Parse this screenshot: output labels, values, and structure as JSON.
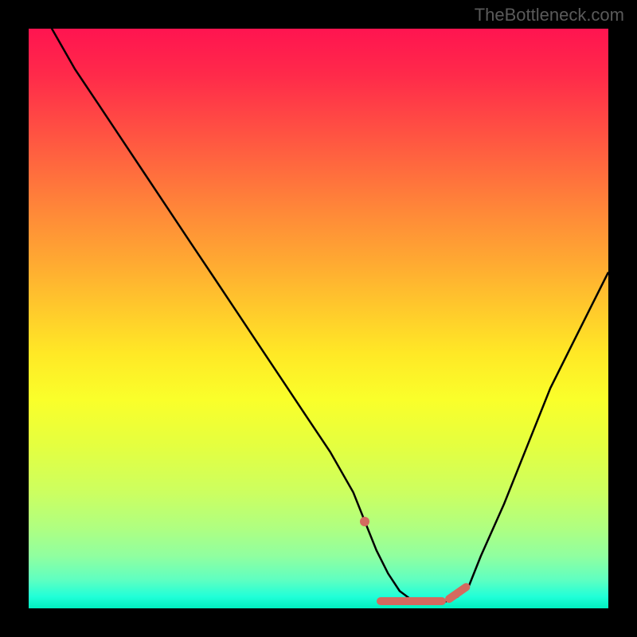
{
  "watermark": "TheBottleneck.com",
  "colors": {
    "background": "#000000",
    "curve": "#000000",
    "marker": "#d46a5f",
    "gradient_top": "#ff1450",
    "gradient_mid": "#ffe826",
    "gradient_bottom": "#00f0c0"
  },
  "chart_data": {
    "type": "line",
    "title": "",
    "xlabel": "",
    "ylabel": "",
    "xlim": [
      0,
      100
    ],
    "ylim": [
      0,
      100
    ],
    "x": [
      0,
      4,
      8,
      12,
      16,
      20,
      24,
      28,
      32,
      36,
      40,
      44,
      48,
      52,
      56,
      58,
      60,
      62,
      64,
      66,
      68,
      70,
      72,
      74,
      76,
      78,
      82,
      86,
      90,
      94,
      98,
      100
    ],
    "y": [
      112,
      100,
      93,
      87,
      81,
      75,
      69,
      63,
      57,
      51,
      45,
      39,
      33,
      27,
      20,
      15,
      10,
      6,
      3,
      1.5,
      1,
      1,
      1.2,
      2,
      4,
      9,
      18,
      28,
      38,
      46,
      54,
      58
    ],
    "grid": false,
    "marker_region": {
      "x_start": 58,
      "x_end": 76,
      "note": "highlighted optimal zone near curve minimum"
    }
  }
}
